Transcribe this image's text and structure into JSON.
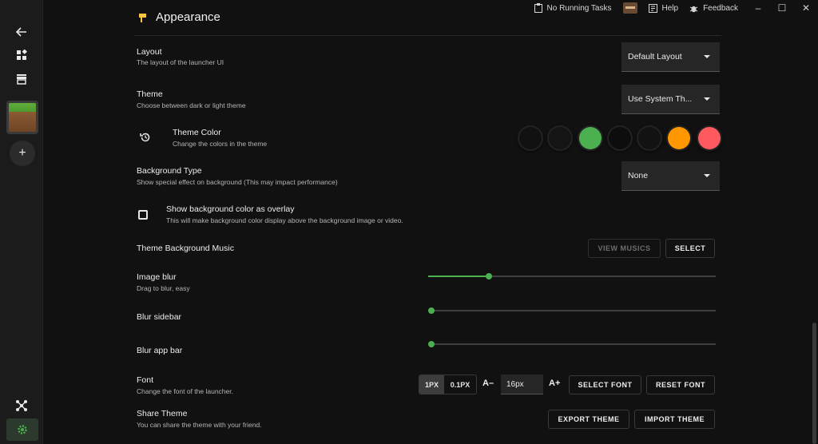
{
  "topbar": {
    "tasks": "No Running Tasks",
    "help": "Help",
    "feedback": "Feedback",
    "minimize": "–",
    "maximize": "☐",
    "close": "✕"
  },
  "sidebar": {
    "back_icon": "arrow-left-icon",
    "add": "+"
  },
  "heading": "Appearance",
  "layout": {
    "label": "Layout",
    "desc": "The layout of the launcher UI",
    "value": "Default Layout"
  },
  "theme": {
    "label": "Theme",
    "desc": "Choose between dark or light theme",
    "value": "Use System Th..."
  },
  "theme_color": {
    "label": "Theme Color",
    "desc": "Change the colors in the theme",
    "swatches": [
      "#111111",
      "#141414",
      "#4caf50",
      "#0d0d0d",
      "#121212",
      "#ff9800",
      "#ff5a5f"
    ]
  },
  "background_type": {
    "label": "Background Type",
    "desc": "Show special effect on background (This may impact performance)",
    "value": "None"
  },
  "overlay": {
    "label": "Show background color as overlay",
    "desc": "This will make background color display above the background image or video.",
    "checked": false
  },
  "music": {
    "label": "Theme Background Music",
    "view": "VIEW MUSICS",
    "select": "SELECT"
  },
  "image_blur": {
    "label": "Image blur",
    "desc": "Drag to blur, easy",
    "value_fraction": 0.2
  },
  "blur_sidebar": {
    "label": "Blur sidebar",
    "value_fraction": 0
  },
  "blur_appbar": {
    "label": "Blur app bar",
    "value_fraction": 0
  },
  "font": {
    "label": "Font",
    "desc": "Change the font of the launcher.",
    "step_options": [
      "1PX",
      "0.1PX"
    ],
    "decrease": "A–",
    "size": "16px",
    "increase": "A+",
    "select": "SELECT FONT",
    "reset": "RESET FONT"
  },
  "share": {
    "label": "Share Theme",
    "desc": "You can share the theme with your friend.",
    "export": "EXPORT THEME",
    "import": "IMPORT THEME"
  },
  "colors": {
    "accent": "#4caf50",
    "bg": "#111111",
    "sidebar": "#1b1b1b"
  }
}
